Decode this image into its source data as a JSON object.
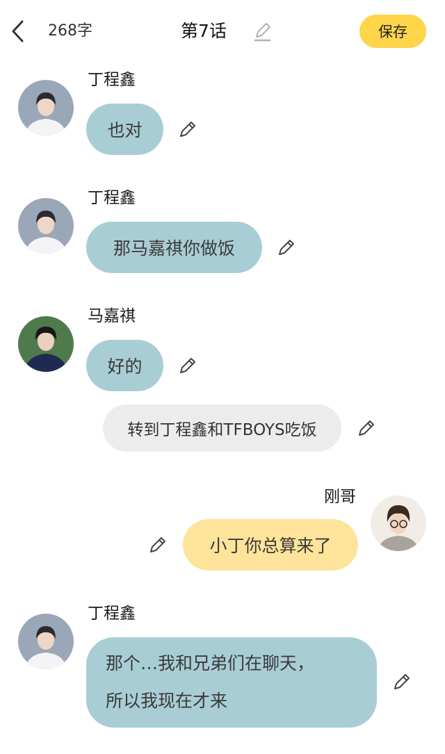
{
  "header": {
    "word_count": "268字",
    "title": "第7话",
    "save_label": "保存"
  },
  "messages": [
    {
      "sender": "丁程鑫",
      "text": "也对"
    },
    {
      "sender": "丁程鑫",
      "text": "那马嘉祺你做饭"
    },
    {
      "sender": "马嘉祺",
      "text": "好的"
    },
    {
      "type": "narration",
      "text": "转到丁程鑫和TFBOYS吃饭"
    },
    {
      "sender": "刚哥",
      "text": "小丁你总算来了"
    },
    {
      "sender": "丁程鑫",
      "lines": [
        "那个…我和兄弟们在聊天，",
        "所以我现在才来"
      ]
    }
  ],
  "colors": {
    "save_button": "#ffd54a",
    "bubble_left": "#a9cdd4",
    "bubble_right": "#fde49a",
    "narration": "#ececec"
  },
  "icons": {
    "back": "chevron-left-icon",
    "edit": "pencil-icon"
  }
}
